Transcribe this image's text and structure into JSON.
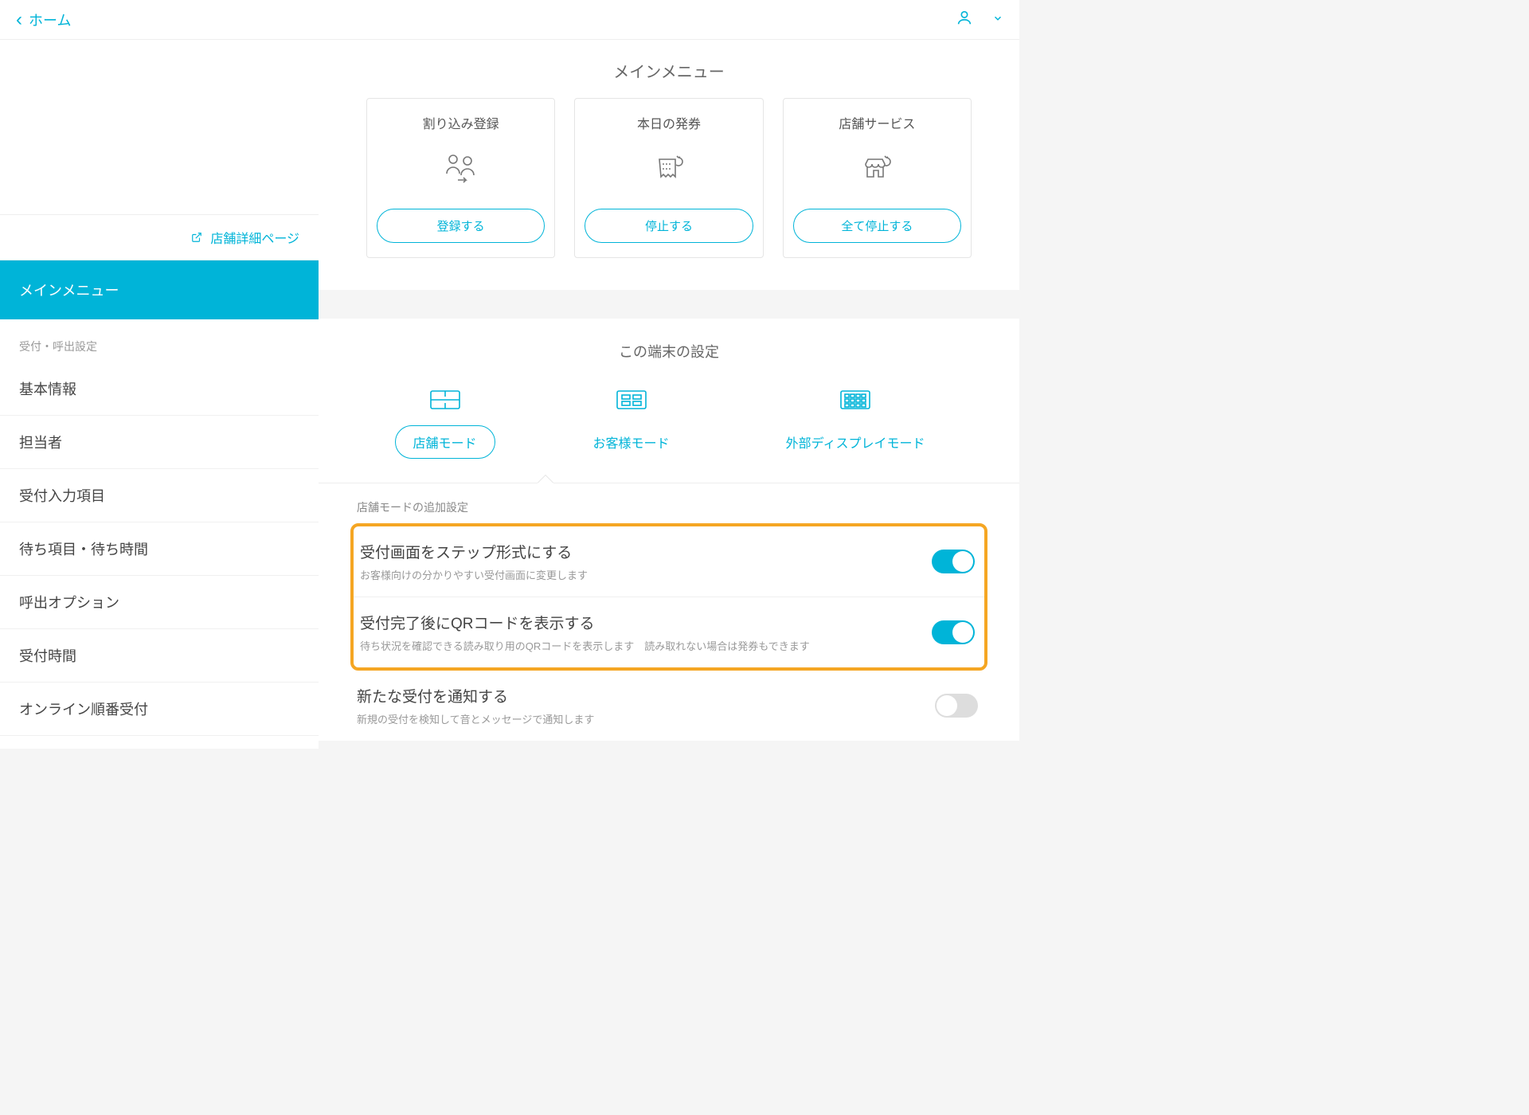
{
  "header": {
    "home_label": "ホーム"
  },
  "sidebar": {
    "store_detail_link": "店舗詳細ページ",
    "active_item": "メインメニュー",
    "section_label": "受付・呼出設定",
    "items": [
      "基本情報",
      "担当者",
      "受付入力項目",
      "待ち項目・待ち時間",
      "呼出オプション",
      "受付時間",
      "オンライン順番受付"
    ]
  },
  "main_menu": {
    "title": "メインメニュー",
    "cards": [
      {
        "title": "割り込み登録",
        "button": "登録する"
      },
      {
        "title": "本日の発券",
        "button": "停止する"
      },
      {
        "title": "店舗サービス",
        "button": "全て停止する"
      }
    ]
  },
  "device_settings": {
    "title": "この端末の設定",
    "modes": [
      "店舗モード",
      "お客様モード",
      "外部ディスプレイモード"
    ],
    "subsection": "店舗モードの追加設定",
    "rows": [
      {
        "title": "受付画面をステップ形式にする",
        "desc": "お客様向けの分かりやすい受付画面に変更します",
        "on": true
      },
      {
        "title": "受付完了後にQRコードを表示する",
        "desc": "待ち状況を確認できる読み取り用のQRコードを表示します　読み取れない場合は発券もできます",
        "on": true
      },
      {
        "title": "新たな受付を通知する",
        "desc": "新規の受付を検知して音とメッセージで通知します",
        "on": false
      }
    ]
  }
}
